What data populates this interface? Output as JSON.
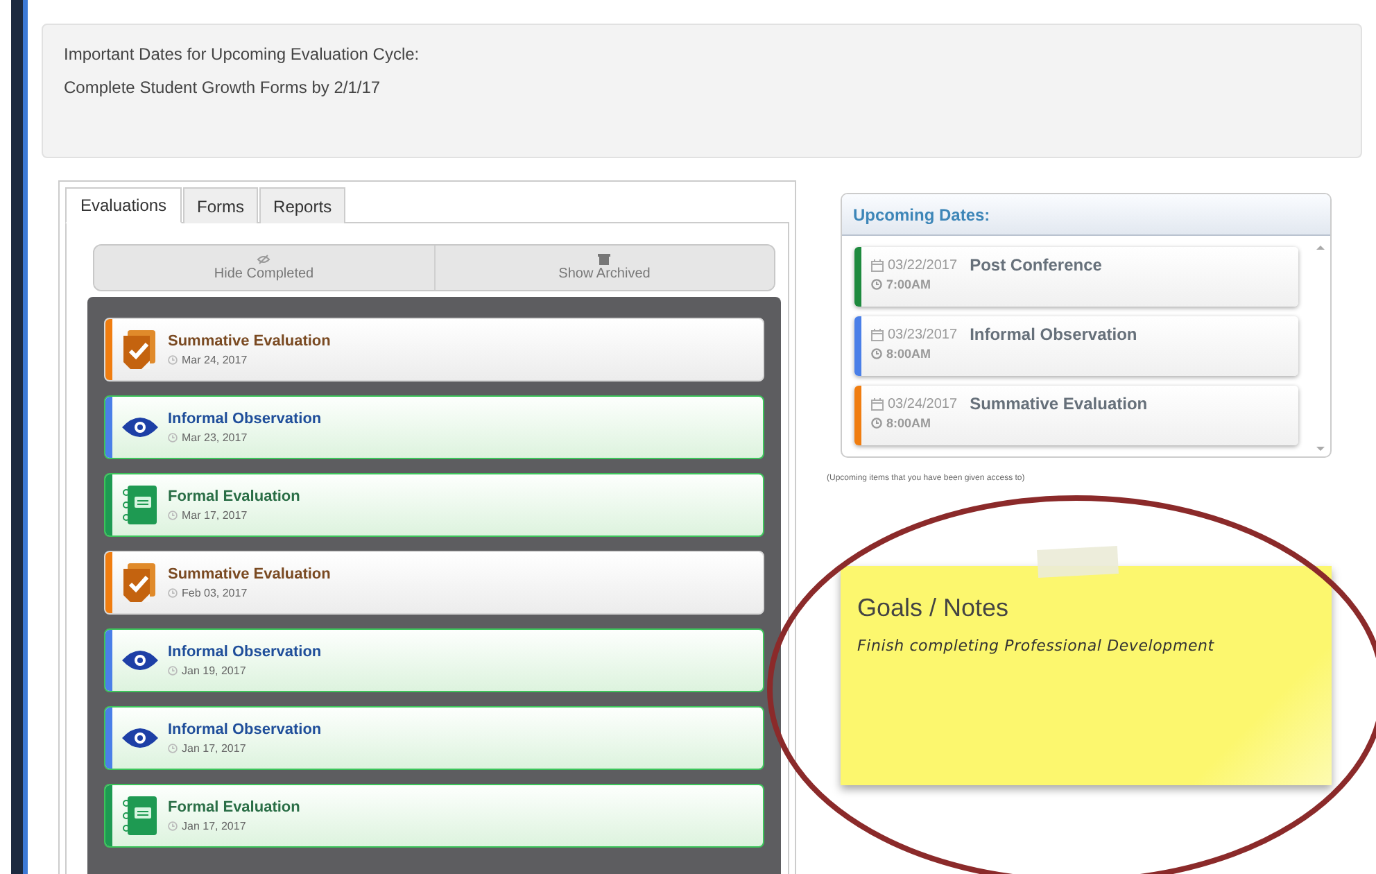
{
  "banner": {
    "lines": [
      "Important Dates for Upcoming Evaluation Cycle:",
      "Complete Student Growth Forms by 2/1/17"
    ]
  },
  "tabs": [
    {
      "label": "Evaluations",
      "selected": true
    },
    {
      "label": "Forms",
      "selected": false
    },
    {
      "label": "Reports",
      "selected": false
    }
  ],
  "toolbar": [
    {
      "kind": "hide",
      "label": "Hide Completed"
    },
    {
      "kind": "archive",
      "label": "Show Archived"
    }
  ],
  "evaluations": [
    {
      "kind": "summative",
      "title": "Summative Evaluation",
      "date": "Mar 24, 2017"
    },
    {
      "kind": "informal",
      "title": "Informal Observation",
      "date": "Mar 23, 2017"
    },
    {
      "kind": "formal",
      "title": "Formal Evaluation",
      "date": "Mar 17, 2017"
    },
    {
      "kind": "summative",
      "title": "Summative Evaluation",
      "date": "Feb 03, 2017"
    },
    {
      "kind": "informal",
      "title": "Informal Observation",
      "date": "Jan 19, 2017"
    },
    {
      "kind": "informal",
      "title": "Informal Observation",
      "date": "Jan 17, 2017"
    },
    {
      "kind": "formal",
      "title": "Formal Evaluation",
      "date": "Jan 17, 2017"
    }
  ],
  "upcoming": {
    "title": "Upcoming Dates:",
    "items": [
      {
        "date": "03/22/2017",
        "time": "7:00AM",
        "title": "Post Conference",
        "color": "#1e8a3e"
      },
      {
        "date": "03/23/2017",
        "time": "8:00AM",
        "title": "Informal Observation",
        "color": "#4a7fe8"
      },
      {
        "date": "03/24/2017",
        "time": "8:00AM",
        "title": "Summative Evaluation",
        "color": "#f07d10"
      }
    ],
    "note": "(Upcoming items that you have been given access to)"
  },
  "notes": {
    "title": "Goals / Notes",
    "text": "Finish completing Professional Development"
  }
}
